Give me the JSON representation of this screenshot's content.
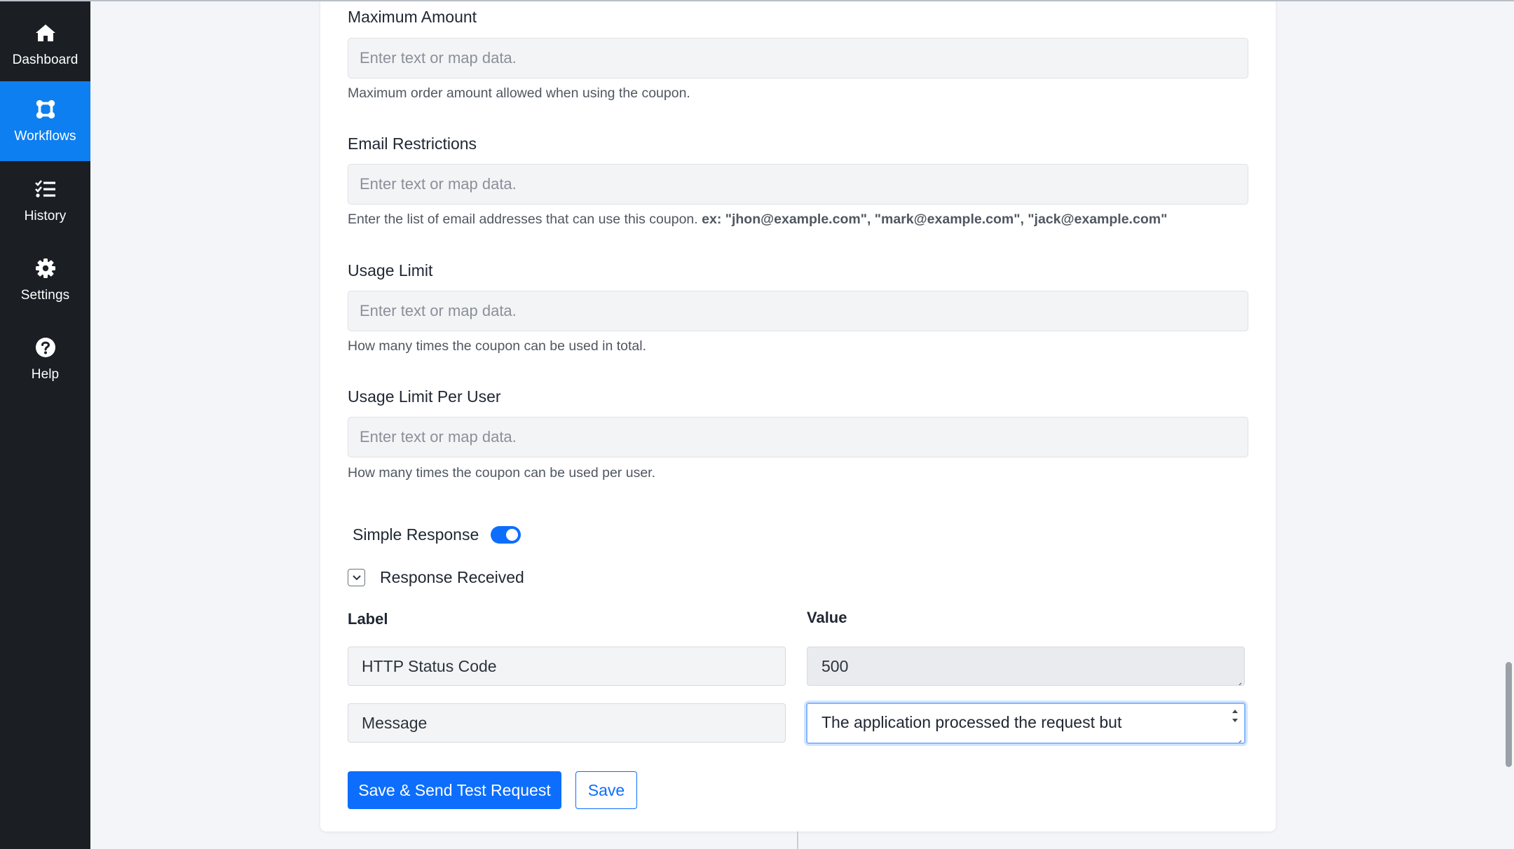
{
  "sidebar": {
    "items": [
      {
        "label": "Dashboard",
        "icon": "home-icon"
      },
      {
        "label": "Workflows",
        "icon": "workflow-icon"
      },
      {
        "label": "History",
        "icon": "list-check-icon"
      },
      {
        "label": "Settings",
        "icon": "gear-icon"
      },
      {
        "label": "Help",
        "icon": "question-circle-icon"
      }
    ],
    "active": "Workflows"
  },
  "fields": [
    {
      "label": "Maximum Amount",
      "placeholder": "Enter text or map data.",
      "help": "Maximum order amount allowed when using the coupon."
    },
    {
      "label": "Email Restrictions",
      "placeholder": "Enter text or map data.",
      "help": "Enter the list of email addresses that can use this coupon.",
      "help_example": "ex: \"jhon@example.com\", \"mark@example.com\", \"jack@example.com\""
    },
    {
      "label": "Usage Limit",
      "placeholder": "Enter text or map data.",
      "help": "How many times the coupon can be used in total."
    },
    {
      "label": "Usage Limit Per User",
      "placeholder": "Enter text or map data.",
      "help": "How many times the coupon can be used per user."
    }
  ],
  "simple_response": {
    "label": "Simple Response",
    "enabled": true
  },
  "response_section": {
    "title": "Response Received",
    "label_header": "Label",
    "value_header": "Value",
    "rows": [
      {
        "label": "HTTP Status Code",
        "value": "500"
      },
      {
        "label": "Message",
        "value": "The application processed the request but"
      }
    ]
  },
  "buttons": {
    "save_send": "Save & Send Test Request",
    "save": "Save"
  },
  "colors": {
    "sidebar_bg": "#1b1f24",
    "active_nav": "#0d7ff0",
    "primary": "#0d6efd"
  }
}
